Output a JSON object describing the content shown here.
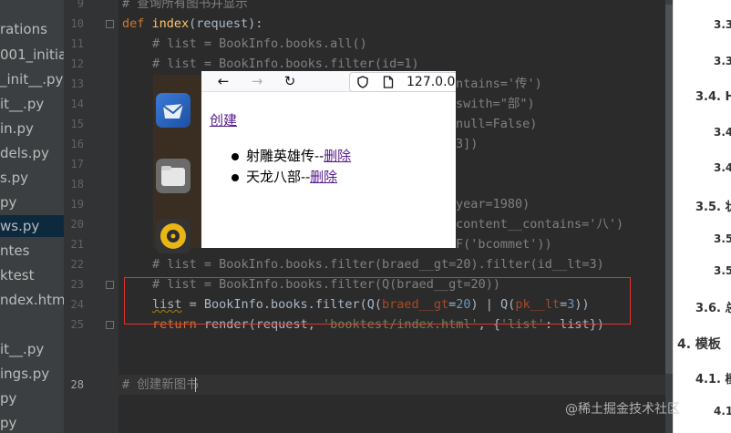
{
  "project_tree": [
    "",
    "rations",
    "001_initial",
    "_init__.py",
    "it__.py",
    "in.py",
    "dels.py",
    "s.py",
    "py",
    "ws.py",
    "ntes",
    "ktest",
    "ndex.html",
    "",
    "",
    "it__.py",
    "ings.py",
    "py",
    "py"
  ],
  "line_numbers": [
    "9",
    "10",
    "11",
    "12",
    "13",
    "14",
    "15",
    "16",
    "17",
    "18",
    "19",
    "20",
    "21",
    "22",
    "23",
    "24",
    "25",
    "",
    "",
    "28"
  ],
  "code": {
    "l9": "# 查询所有图书并显示",
    "l10_def": "def ",
    "l10_name": "index",
    "l10_rest": "(request):",
    "l11": "# list = BookInfo.books.all()",
    "l12": "# list = BookInfo.books.filter(id=1)",
    "l13": "ntains='传')",
    "l14": "swith=\"部\")",
    "l15": "null=False)",
    "l16": "3])",
    "l19": "year=1980)",
    "l20": "content__contains='八')",
    "l21": "F('bcommet'))",
    "l22": "# list = BookInfo.books.filter(braed__gt=20).filter(id__lt=3)",
    "l23": "# list = BookInfo.books.filter(Q(braed__gt=20))",
    "l24": {
      "var": "list",
      "a": " = BookInfo.books.filter(Q(",
      "k1": "braed__gt",
      "b": "=",
      "n1": "20",
      "c": ") | Q(",
      "k2": "pk__lt",
      "d": "=",
      "n2": "3",
      "e": "))"
    },
    "l25": {
      "kw": "return ",
      "a": "render(request, ",
      "s1": "'booktest/index.html'",
      "b": ", {",
      "s2": "'list'",
      "c": ": list})"
    },
    "l28": "# 创建新图书"
  },
  "browser": {
    "back": "←",
    "forward": "→",
    "reload": "↻",
    "url": "127.0.0.",
    "create_link": "创建",
    "books": [
      {
        "title": "射雕英雄传--",
        "delete": "删除"
      },
      {
        "title": "天龙八部--",
        "delete": "删除"
      }
    ]
  },
  "outline": [
    "3.3",
    "3.3",
    "3.4. Ht",
    "3.4",
    "3.4",
    "3.5. 状",
    "3.5",
    "3.5",
    "3.6. 总",
    "4. 模板",
    "4.1. 模",
    "4.1"
  ],
  "watermark": "@稀土掘金技术社区",
  "colors": {
    "highlight_box": "#e5322d",
    "keyword": "#cc7832",
    "string": "#6a8759",
    "comment": "#808080"
  }
}
